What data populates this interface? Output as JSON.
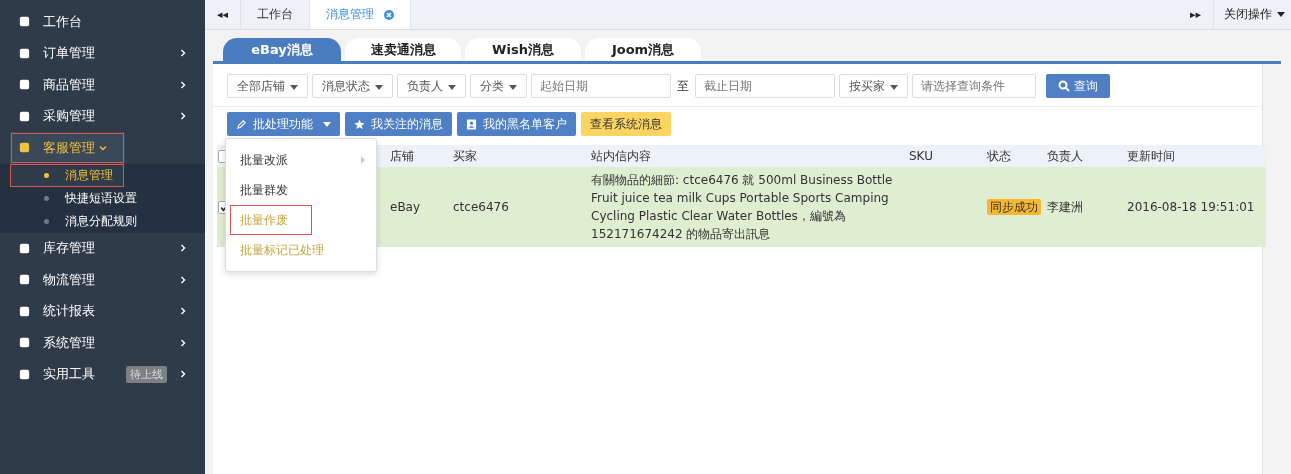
{
  "sidebar": {
    "items": [
      {
        "label": "工作台",
        "expanded": false,
        "highlighted": false,
        "arrow": false
      },
      {
        "label": "订单管理",
        "expanded": false,
        "highlighted": false,
        "arrow": true
      },
      {
        "label": "商品管理",
        "expanded": false,
        "highlighted": false,
        "arrow": true
      },
      {
        "label": "采购管理",
        "expanded": false,
        "highlighted": false,
        "arrow": true
      },
      {
        "label": "客服管理",
        "expanded": true,
        "highlighted": true,
        "arrow": true,
        "children": [
          {
            "label": "消息管理",
            "selected": true
          },
          {
            "label": "快捷短语设置",
            "selected": false
          },
          {
            "label": "消息分配规则",
            "selected": false
          }
        ]
      },
      {
        "label": "库存管理",
        "expanded": false,
        "highlighted": false,
        "arrow": true
      },
      {
        "label": "物流管理",
        "expanded": false,
        "highlighted": false,
        "arrow": true
      },
      {
        "label": "统计报表",
        "expanded": false,
        "highlighted": false,
        "arrow": true
      },
      {
        "label": "系统管理",
        "expanded": false,
        "highlighted": false,
        "arrow": true
      },
      {
        "label": "实用工具",
        "expanded": false,
        "highlighted": false,
        "arrow": true,
        "badge": "待上线"
      }
    ]
  },
  "top_tabs": {
    "back": "◂◂",
    "tabs": [
      {
        "label": "工作台",
        "selected": false,
        "closable": false
      },
      {
        "label": "消息管理",
        "selected": true,
        "closable": true
      }
    ],
    "forward": "▸▸",
    "close_ops": "关闭操作"
  },
  "platform_tabs": [
    {
      "label": "eBay消息",
      "selected": true
    },
    {
      "label": "速卖通消息",
      "selected": false
    },
    {
      "label": "Wish消息",
      "selected": false
    },
    {
      "label": "Joom消息",
      "selected": false
    }
  ],
  "filters": {
    "dropdowns": [
      "全部店铺",
      "消息状态",
      "负责人",
      "分类"
    ],
    "start_date": {
      "placeholder": "起始日期"
    },
    "to": "至",
    "end_date": {
      "placeholder": "截止日期"
    },
    "by": "按买家",
    "query": {
      "placeholder": "请选择查询条件"
    },
    "search": "查询"
  },
  "actions": [
    {
      "label": "批处理功能",
      "kind": "menu"
    },
    {
      "label": "我关注的消息",
      "kind": "star"
    },
    {
      "label": "我的黑名单客户",
      "kind": "contact"
    },
    {
      "label": "查看系统消息",
      "kind": "warning"
    }
  ],
  "batch_menu": [
    {
      "label": "批量改派",
      "submenu": true,
      "disabled": false,
      "highlighted": false
    },
    {
      "label": "批量群发",
      "submenu": false,
      "disabled": false,
      "highlighted": false
    },
    {
      "label": "批量作废",
      "submenu": false,
      "disabled": true,
      "highlighted": true
    },
    {
      "label": "批量标记已处理",
      "submenu": false,
      "disabled": true,
      "highlighted": false
    }
  ],
  "table": {
    "all_checked": false,
    "columns": [
      "店铺",
      "买家",
      "站内信内容",
      "SKU",
      "状态",
      "负责人",
      "更新时间"
    ],
    "rows": [
      {
        "checked": true,
        "selected": true,
        "cells": [
          "eBay",
          "ctce6476",
          "有關物品的細節: ctce6476 就 500ml Business Bottle Fruit juice tea milk Cups Portable Sports Camping Cycling Plastic Clear Water Bottles，編號為152171674242 的物品寄出訊息",
          "",
          "同步成功",
          "李建洲",
          "2016-08-18 19:51:01"
        ]
      }
    ]
  }
}
